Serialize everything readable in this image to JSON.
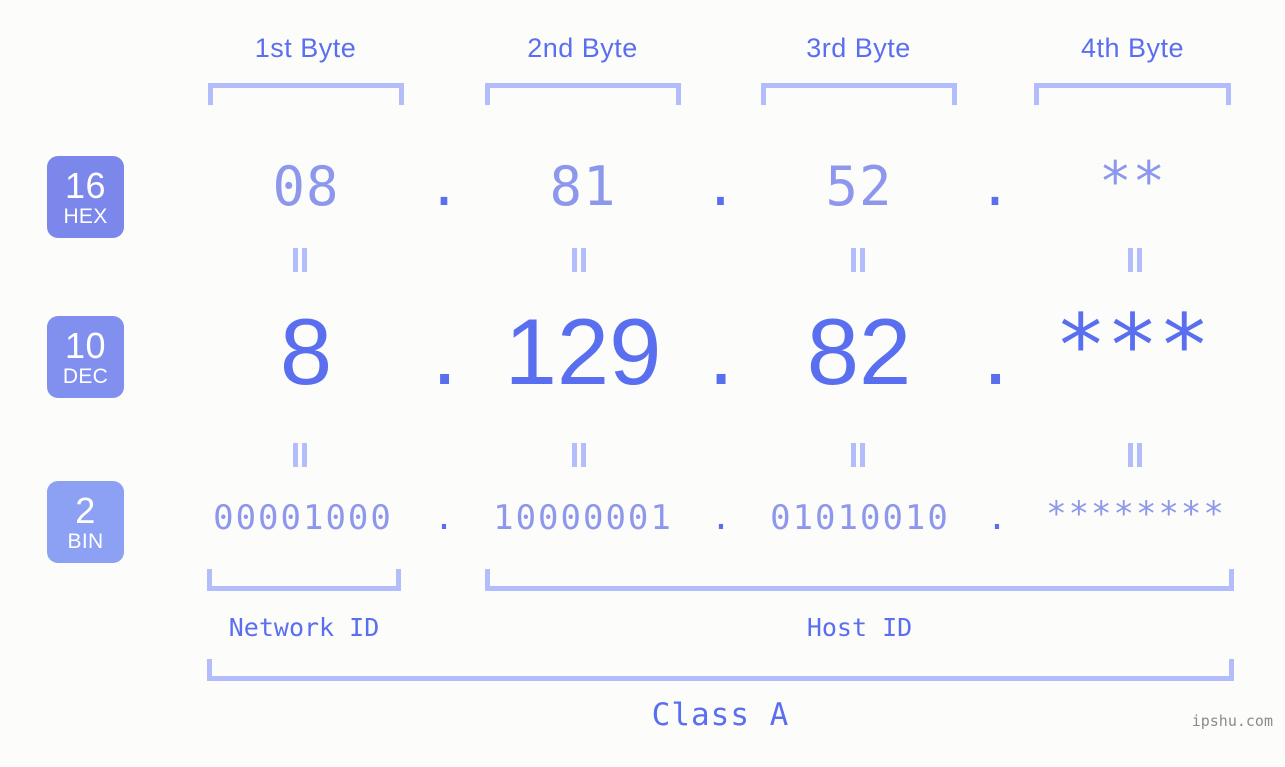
{
  "background_color": "#fcfdfa",
  "accent_color": "#5a6ef0",
  "muted_color": "#8d98ec",
  "bracket_color": "#b4bdfb",
  "headers": {
    "byte1": "1st Byte",
    "byte2": "2nd Byte",
    "byte3": "3rd Byte",
    "byte4": "4th Byte"
  },
  "bases": [
    {
      "number": "16",
      "label": "HEX",
      "color": "#7b87ea"
    },
    {
      "number": "10",
      "label": "DEC",
      "color": "#8190ef"
    },
    {
      "number": "2",
      "label": "BIN",
      "color": "#8ca0f4"
    }
  ],
  "rows": {
    "hex": {
      "base_number": "16",
      "base_label": "HEX",
      "octets": [
        "08",
        "81",
        "52",
        "**"
      ],
      "separator": "."
    },
    "dec": {
      "base_number": "10",
      "base_label": "DEC",
      "octets": [
        "8",
        "129",
        "82",
        "***"
      ],
      "separator": "."
    },
    "bin": {
      "base_number": "2",
      "base_label": "BIN",
      "octets": [
        "00001000",
        "10000001",
        "01010010",
        "********"
      ],
      "separator": "."
    }
  },
  "segments": {
    "network_id": "Network ID",
    "host_id": "Host ID",
    "class": "Class A"
  },
  "watermark": "ipshu.com"
}
